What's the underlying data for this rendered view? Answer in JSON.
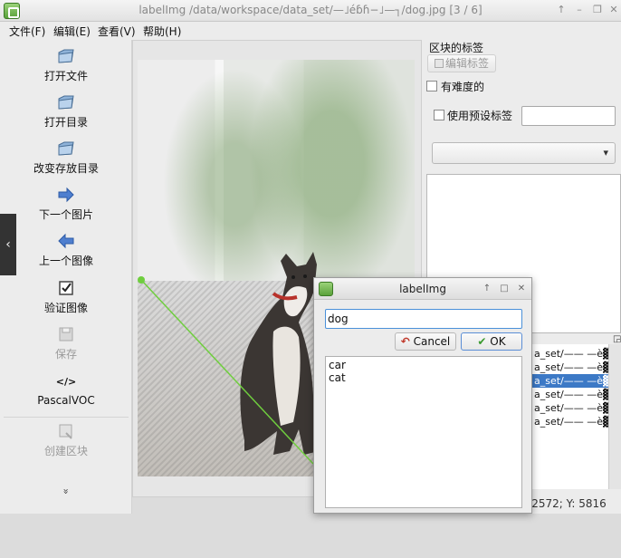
{
  "window": {
    "title": "labelImg /data/workspace/data_set/—˩éɓɦ−˩—┐/dog.jpg [3 / 6]",
    "controls": [
      "↑",
      "–",
      "❐",
      "✕"
    ]
  },
  "menu": {
    "file": "文件(F)",
    "edit": "编辑(E)",
    "view": "查看(V)",
    "help": "帮助(H)"
  },
  "toolbar": {
    "open_file": "打开文件",
    "open_dir": "打开目录",
    "change_save_dir": "改变存放目录",
    "next_image": "下一个图片",
    "prev_image": "上一个图像",
    "verify_image": "验证图像",
    "save": "保存",
    "format_icon": "</>",
    "format": "PascalVOC",
    "create_box": "创建区块",
    "more": "»"
  },
  "nav": {
    "left": "‹",
    "right": "›"
  },
  "dock": {
    "title": "区块的标签",
    "edit_label_button": "编辑标签",
    "difficult_label": "有难度的",
    "use_default_label": "使用预设标签",
    "default_label_value": "",
    "combo_arrow": "▾",
    "file_list_header_icon": "◲",
    "file_list": [
      "a_set/—— —è▓ɓ—",
      "a_set/—— —è▓ɓ—",
      "a_set/—— —è▓ɓ—",
      "a_set/—— —è▓ɓ—",
      "a_set/—— —è▓ɓ—",
      "a_set/—— —è▓ɓ—"
    ],
    "selected_index": 2
  },
  "status": {
    "text": "Y X: 2572; Y: 5816"
  },
  "dialog": {
    "title": "labelImg",
    "input_value": "dog",
    "cancel_label": "Cancel",
    "ok_label": "OK",
    "cancel_icon": "↶",
    "ok_icon": "✔",
    "labels": [
      "car",
      "cat"
    ],
    "controls": [
      "↑",
      "□",
      "✕"
    ]
  },
  "colors": {
    "accent": "#3c79c6",
    "box_line": "#6fce3e",
    "ok_border": "#5b8ed6"
  }
}
